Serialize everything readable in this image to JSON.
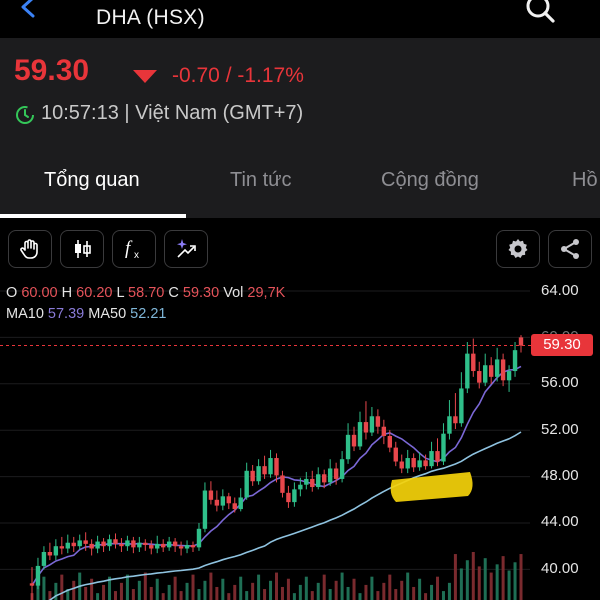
{
  "header": {
    "title": "DHA (HSX)",
    "back_icon": "chevron-left-icon",
    "search_icon": "search-icon"
  },
  "quote": {
    "price": "59.30",
    "change": "-0.70 / -1.17%",
    "time": "10:57:13 | Việt Nam (GMT+7)",
    "direction_icon": "down-triangle-icon",
    "colors": {
      "down": "#e8353a",
      "muted": "#c9c9c9"
    }
  },
  "tabs": [
    {
      "label": "Tổng quan",
      "active": true
    },
    {
      "label": "Tin tức",
      "active": false
    },
    {
      "label": "Cộng đồng",
      "active": false
    },
    {
      "label": "Hồ",
      "active": false
    }
  ],
  "toolbar": {
    "left": [
      "hand-icon",
      "candlestick-icon",
      "function-icon",
      "ai-magic-icon"
    ],
    "right": [
      "settings-icon",
      "share-icon"
    ]
  },
  "legend": {
    "o_label": "O",
    "o": "60.00",
    "h_label": "H",
    "h": "60.20",
    "l_label": "L",
    "l": "58.70",
    "c_label": "C",
    "c": "59.30",
    "vol_label": "Vol",
    "vol": "29,7K",
    "ma10_label": "MA10",
    "ma10": "57.39",
    "ma50_label": "MA50",
    "ma50": "52.21"
  },
  "chart_data": {
    "type": "candlestick",
    "y_ticks": [
      "64.00",
      "60.00",
      "56.00",
      "52.00",
      "48.00",
      "44.00",
      "40.00"
    ],
    "ylim": [
      39,
      65
    ],
    "current_price_label": "59.30",
    "current_price": 59.3,
    "candles": [
      [
        38.8,
        38.6,
        40.2,
        37.0
      ],
      [
        38.6,
        40.3,
        41.0,
        38.3
      ],
      [
        40.3,
        41.5,
        42.0,
        40.0
      ],
      [
        41.5,
        41.2,
        42.3,
        40.8
      ],
      [
        41.2,
        42.0,
        42.6,
        40.8
      ],
      [
        42.0,
        41.8,
        42.8,
        41.3
      ],
      [
        41.8,
        42.3,
        43.0,
        41.4
      ],
      [
        42.3,
        42.0,
        42.8,
        41.5
      ],
      [
        42.0,
        42.5,
        43.0,
        41.7
      ],
      [
        42.5,
        42.2,
        43.2,
        41.6
      ],
      [
        42.2,
        41.8,
        42.6,
        41.2
      ],
      [
        41.8,
        42.4,
        42.9,
        41.4
      ],
      [
        42.4,
        42.0,
        42.7,
        41.5
      ],
      [
        42.0,
        42.6,
        43.0,
        41.6
      ],
      [
        42.6,
        42.2,
        43.1,
        41.8
      ],
      [
        42.2,
        42.0,
        42.7,
        41.5
      ],
      [
        42.0,
        42.5,
        42.9,
        41.6
      ],
      [
        42.5,
        41.9,
        42.8,
        41.4
      ],
      [
        41.9,
        42.3,
        42.8,
        41.5
      ],
      [
        42.3,
        42.1,
        42.6,
        41.6
      ],
      [
        42.1,
        41.8,
        42.5,
        41.3
      ],
      [
        41.8,
        42.2,
        42.9,
        41.4
      ],
      [
        42.2,
        41.9,
        42.6,
        41.5
      ],
      [
        41.9,
        42.4,
        42.8,
        41.6
      ],
      [
        42.4,
        42.0,
        42.7,
        41.5
      ],
      [
        42.0,
        41.8,
        42.4,
        41.2
      ],
      [
        41.8,
        42.1,
        42.5,
        41.4
      ],
      [
        42.1,
        41.9,
        42.4,
        41.5
      ],
      [
        41.9,
        43.5,
        44.0,
        41.6
      ],
      [
        43.5,
        46.8,
        47.5,
        43.2
      ],
      [
        46.8,
        46.0,
        47.6,
        45.6
      ],
      [
        46.0,
        45.5,
        46.8,
        45.0
      ],
      [
        45.5,
        46.3,
        46.9,
        45.1
      ],
      [
        46.3,
        45.7,
        46.6,
        45.2
      ],
      [
        45.7,
        45.2,
        46.2,
        44.9
      ],
      [
        45.2,
        46.2,
        47.0,
        45.0
      ],
      [
        46.2,
        48.5,
        49.2,
        46.0
      ],
      [
        48.5,
        47.6,
        49.0,
        47.2
      ],
      [
        47.6,
        48.9,
        49.5,
        47.3
      ],
      [
        48.9,
        48.2,
        49.8,
        47.8
      ],
      [
        48.2,
        49.6,
        50.3,
        47.9
      ],
      [
        49.6,
        48.1,
        50.0,
        47.5
      ],
      [
        48.1,
        46.6,
        48.5,
        46.2
      ],
      [
        46.6,
        45.8,
        47.2,
        45.3
      ],
      [
        45.8,
        46.9,
        47.5,
        45.4
      ],
      [
        46.9,
        47.3,
        47.9,
        46.3
      ],
      [
        47.3,
        47.8,
        48.4,
        46.9
      ],
      [
        47.8,
        47.1,
        48.5,
        46.7
      ],
      [
        47.1,
        48.2,
        48.8,
        46.9
      ],
      [
        48.2,
        47.5,
        48.6,
        47.0
      ],
      [
        47.5,
        48.7,
        49.5,
        47.2
      ],
      [
        48.7,
        47.8,
        49.2,
        47.3
      ],
      [
        47.8,
        49.5,
        50.2,
        47.5
      ],
      [
        49.5,
        51.6,
        52.6,
        49.1
      ],
      [
        51.6,
        50.6,
        52.3,
        50.2
      ],
      [
        50.6,
        52.7,
        53.6,
        50.3
      ],
      [
        52.7,
        51.8,
        54.5,
        51.2
      ],
      [
        51.8,
        53.2,
        54.0,
        51.5
      ],
      [
        53.2,
        52.3,
        53.8,
        51.7
      ],
      [
        52.3,
        51.5,
        52.9,
        50.8
      ],
      [
        51.5,
        50.5,
        52.0,
        50.1
      ],
      [
        50.5,
        49.3,
        51.0,
        48.9
      ],
      [
        49.3,
        48.7,
        49.9,
        48.3
      ],
      [
        48.7,
        49.6,
        50.3,
        48.3
      ],
      [
        49.6,
        48.8,
        50.0,
        48.4
      ],
      [
        48.8,
        49.4,
        50.1,
        48.5
      ],
      [
        49.4,
        48.9,
        49.9,
        48.6
      ],
      [
        48.9,
        50.2,
        51.0,
        48.7
      ],
      [
        50.2,
        49.3,
        51.3,
        48.9
      ],
      [
        49.3,
        51.7,
        52.6,
        49.0
      ],
      [
        51.7,
        53.2,
        54.6,
        51.2
      ],
      [
        53.2,
        52.6,
        55.2,
        52.1
      ],
      [
        52.6,
        55.6,
        57.0,
        52.3
      ],
      [
        55.6,
        58.6,
        59.6,
        55.2
      ],
      [
        58.6,
        57.1,
        59.9,
        56.6
      ],
      [
        57.1,
        56.1,
        57.9,
        55.6
      ],
      [
        56.1,
        57.6,
        58.6,
        55.8
      ],
      [
        57.6,
        56.6,
        58.3,
        56.0
      ],
      [
        56.6,
        58.1,
        59.1,
        56.2
      ],
      [
        58.1,
        56.3,
        58.6,
        55.8
      ],
      [
        56.3,
        57.1,
        57.6,
        55.3
      ],
      [
        57.1,
        58.9,
        59.6,
        56.6
      ],
      [
        60.0,
        59.3,
        60.2,
        58.7
      ]
    ],
    "volume_max": 14000
  }
}
